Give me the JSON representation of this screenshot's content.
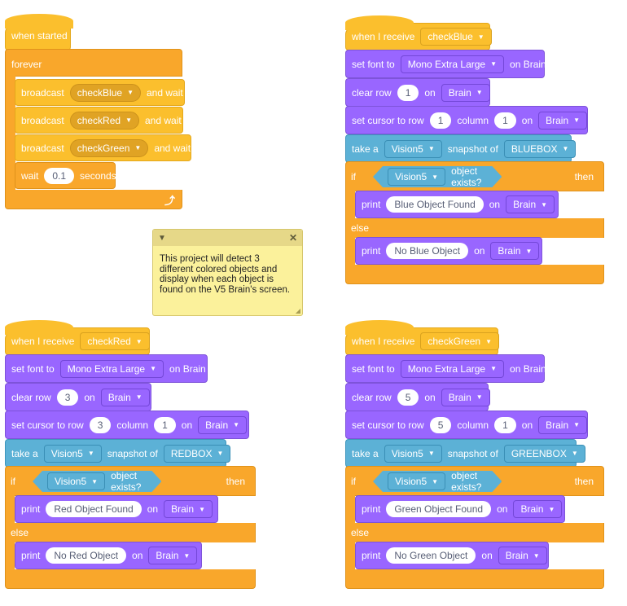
{
  "main_script": {
    "hat_label": "when started",
    "forever_label": "forever",
    "broadcasts": [
      {
        "label": "broadcast",
        "message": "checkBlue",
        "suffix": "and wait"
      },
      {
        "label": "broadcast",
        "message": "checkRed",
        "suffix": "and wait"
      },
      {
        "label": "broadcast",
        "message": "checkGreen",
        "suffix": "and wait"
      }
    ],
    "wait": {
      "label": "wait",
      "value": "0.1",
      "suffix": "seconds"
    },
    "loop_icon": "loop-arrow-icon"
  },
  "comment": {
    "collapse_icon": "chevron-down-icon",
    "close_icon": "close-icon",
    "text": "This project will detect 3 different colored objects and display when each object is found on the V5 Brain's screen."
  },
  "scripts": [
    {
      "id": "blue",
      "receive_label": "when I receive",
      "message": "checkBlue",
      "font_label": "set font to",
      "font": "Mono Extra Large",
      "font_on": "on Brain",
      "clear_label": "clear row",
      "clear_row": "1",
      "on": "on",
      "device": "Brain",
      "cursor_label": "set cursor to row",
      "cursor_row": "1",
      "column_label": "column",
      "cursor_col": "1",
      "snap_label": "take a",
      "sensor": "Vision5",
      "snap_of": "snapshot of",
      "signature": "BLUEBOX",
      "if_label": "if",
      "exists_label": "object exists?",
      "then_label": "then",
      "else_label": "else",
      "print_label": "print",
      "found_text": "Blue Object Found",
      "notfound_text": "No Blue Object"
    },
    {
      "id": "red",
      "receive_label": "when I receive",
      "message": "checkRed",
      "font_label": "set font to",
      "font": "Mono Extra Large",
      "font_on": "on Brain",
      "clear_label": "clear row",
      "clear_row": "3",
      "on": "on",
      "device": "Brain",
      "cursor_label": "set cursor to row",
      "cursor_row": "3",
      "column_label": "column",
      "cursor_col": "1",
      "snap_label": "take a",
      "sensor": "Vision5",
      "snap_of": "snapshot of",
      "signature": "REDBOX",
      "if_label": "if",
      "exists_label": "object exists?",
      "then_label": "then",
      "else_label": "else",
      "print_label": "print",
      "found_text": "Red Object Found",
      "notfound_text": "No Red Object"
    },
    {
      "id": "green",
      "receive_label": "when I receive",
      "message": "checkGreen",
      "font_label": "set font to",
      "font": "Mono Extra Large",
      "font_on": "on Brain",
      "clear_label": "clear row",
      "clear_row": "5",
      "on": "on",
      "device": "Brain",
      "cursor_label": "set cursor to row",
      "cursor_row": "5",
      "column_label": "column",
      "cursor_col": "1",
      "snap_label": "take a",
      "sensor": "Vision5",
      "snap_of": "snapshot of",
      "signature": "GREENBOX",
      "if_label": "if",
      "exists_label": "object exists?",
      "then_label": "then",
      "else_label": "else",
      "print_label": "print",
      "found_text": "Green Object Found",
      "notfound_text": "No Green Object"
    }
  ],
  "colors": {
    "events": "#fbbf2d",
    "control": "#f9a72b",
    "looks": "#9966ff",
    "sensing": "#5cb1d6",
    "comment": "#fbf19b"
  }
}
